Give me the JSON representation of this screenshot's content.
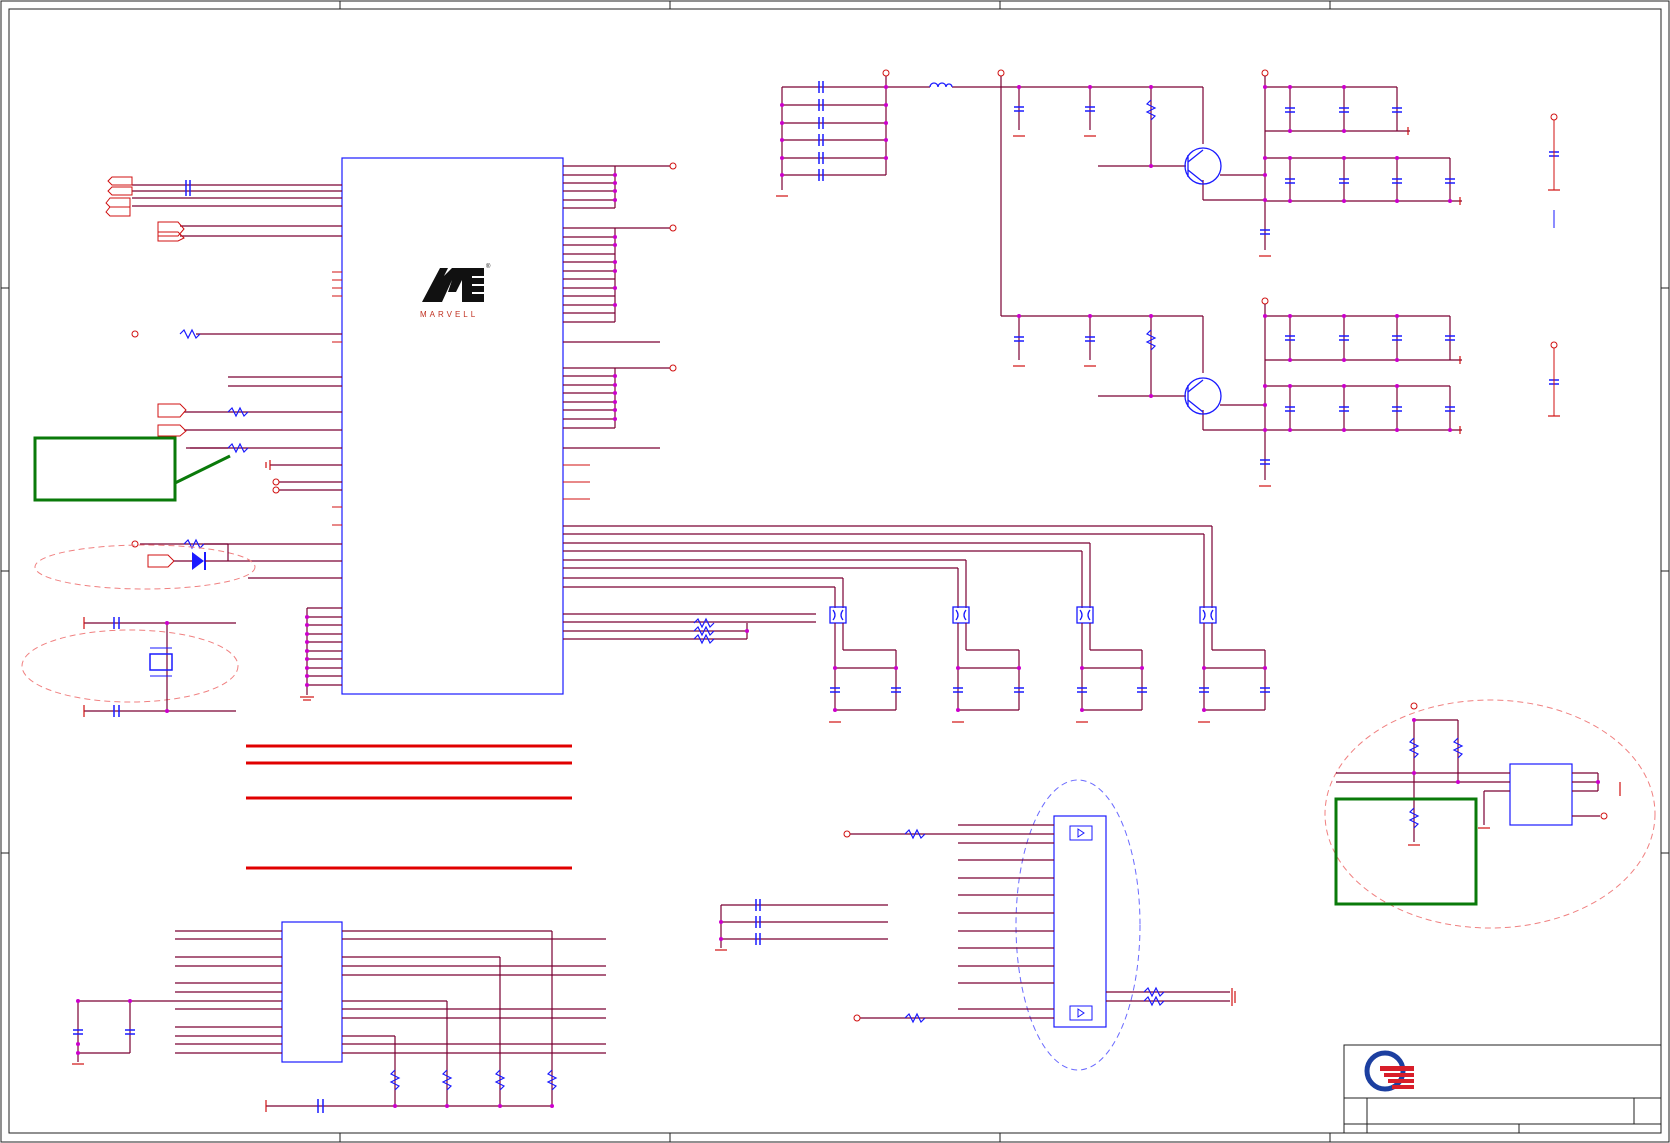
{
  "brand": {
    "vendor_logo_text": "MARVELL",
    "vendor_logo_mark": "M",
    "registered_mark": "®"
  },
  "title_block": {
    "company_logo": "quanta-logo-icon"
  },
  "colors": {
    "wire": "#7a0033",
    "pin": "#d01010",
    "component": "#1a1aff",
    "junction": "#cc00cc",
    "note_box": "#0a7a0a",
    "highlight_bar": "#e00000"
  },
  "icons": [
    "npn-transistor-icon",
    "diode-icon",
    "crystal-icon",
    "ferrite-bead-icon",
    "capacitor-icon",
    "resistor-icon",
    "ground-icon",
    "inductor-icon",
    "quanta-logo-icon",
    "marvell-logo-icon"
  ]
}
